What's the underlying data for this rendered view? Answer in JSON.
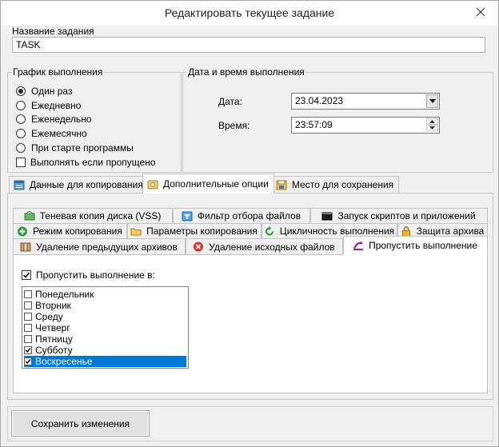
{
  "window": {
    "title": "Редактировать текущее задание"
  },
  "task_name": {
    "label": "Название задания",
    "value": "TASK"
  },
  "schedule": {
    "label": "График выполнения",
    "options": [
      {
        "label": "Один раз",
        "checked": true
      },
      {
        "label": "Ежедневно",
        "checked": false
      },
      {
        "label": "Еженедельно",
        "checked": false
      },
      {
        "label": "Ежемесячно",
        "checked": false
      },
      {
        "label": "При старте программы",
        "checked": false
      }
    ],
    "run_if_missed": {
      "label": "Выполнять если пропущено",
      "checked": false
    }
  },
  "datetime": {
    "label": "Дата и время выполнения",
    "date_label": "Дата:",
    "date_value": "23.04.2023",
    "time_label": "Время:",
    "time_value": "23:57:09"
  },
  "main_tabs": [
    {
      "label": "Данные для копирования",
      "icon": "data-icon",
      "active": false
    },
    {
      "label": "Дополнительные опции",
      "icon": "options-icon",
      "active": true
    },
    {
      "label": "Место для сохранения",
      "icon": "save-location-icon",
      "active": false
    }
  ],
  "sub_tabs": {
    "row1": [
      {
        "label": "Теневая копия диска (VSS)",
        "icon": "vss-icon"
      },
      {
        "label": "Фильтр отбора файлов",
        "icon": "filter-icon"
      },
      {
        "label": "Запуск скриптов и приложений",
        "icon": "console-icon"
      }
    ],
    "row2": [
      {
        "label": "Режим копирования",
        "icon": "plus-icon"
      },
      {
        "label": "Параметры копирования",
        "icon": "folder-icon"
      },
      {
        "label": "Цикличность выполнения",
        "icon": "cycle-icon"
      },
      {
        "label": "Защита архива",
        "icon": "lock-icon"
      }
    ],
    "row3": [
      {
        "label": "Удаление предыдущих архивов",
        "icon": "archive-icon"
      },
      {
        "label": "Удаление исходных файлов",
        "icon": "delete-icon"
      },
      {
        "label": "Пропустить выполнение",
        "icon": "skip-icon",
        "active": true
      }
    ]
  },
  "skip": {
    "label": "Пропустить выполнение в:",
    "checked": true,
    "days": [
      {
        "label": "Понедельник",
        "checked": false,
        "selected": false
      },
      {
        "label": "Вторник",
        "checked": false,
        "selected": false
      },
      {
        "label": "Среду",
        "checked": false,
        "selected": false
      },
      {
        "label": "Четверг",
        "checked": false,
        "selected": false
      },
      {
        "label": "Пятницу",
        "checked": false,
        "selected": false
      },
      {
        "label": "Субботу",
        "checked": true,
        "selected": false
      },
      {
        "label": "Воскресенье",
        "checked": true,
        "selected": true
      }
    ]
  },
  "actions": {
    "save_label": "Сохранить изменения"
  },
  "colors": {
    "selection": "#0078d7",
    "accent_red": "#e81123"
  }
}
